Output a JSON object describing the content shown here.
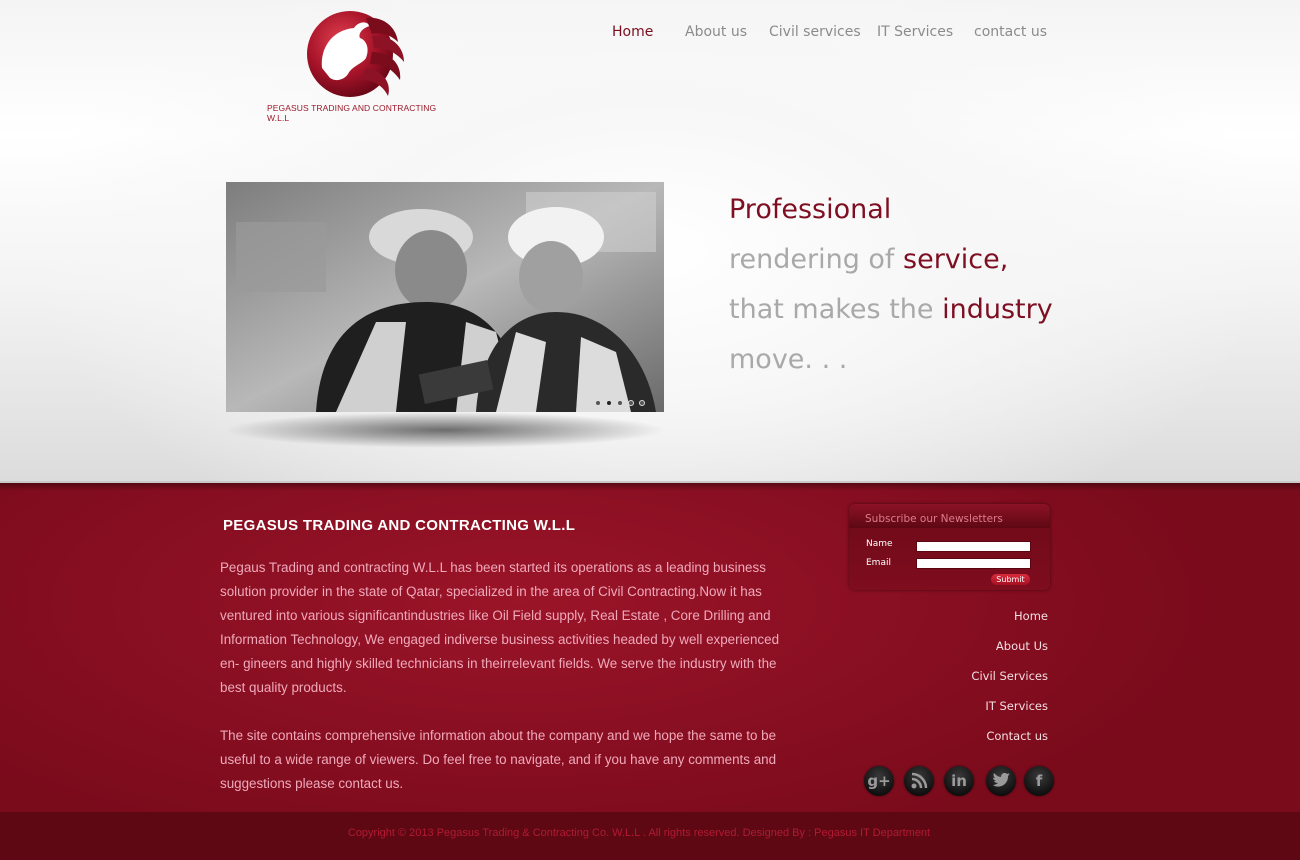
{
  "logo": {
    "text": "PEGASUS TRADING AND CONTRACTING W.L.L"
  },
  "nav": [
    {
      "label": "Home",
      "active": true
    },
    {
      "label": "About us"
    },
    {
      "label": "Civil services"
    },
    {
      "label": "IT Services"
    },
    {
      "label": "contact us"
    }
  ],
  "slider": {
    "dots": 5,
    "active_dot": 2
  },
  "tagline": {
    "line1": {
      "red": "Professional"
    },
    "line2": {
      "grey": "rendering of ",
      "red": "service,"
    },
    "line3": {
      "grey": "that makes the ",
      "red": "industry"
    },
    "line4": {
      "grey": "move. . ."
    }
  },
  "footer": {
    "company_title": "PEGASUS TRADING AND CONTRACTING W.L.L",
    "para1": "Pegaus Trading and contracting W.L.L has been started its operations as a leading business solution provider in the state of Qatar, specialized in the area of Civil Contracting.Now it has ventured into various significantindustries like Oil Field supply, Real Estate , Core Drilling and Information Technology, We engaged indiverse business activities headed by well experienced en- gineers and highly skilled technicians in theirrelevant fields. We serve the industry with the best quality products.",
    "para2": "The site contains comprehensive information about the company and we hope the same to be useful to a wide range of viewers. Do feel free to navigate, and if you have any comments and suggestions please contact us.",
    "newsletter": {
      "title": "Subscribe our Newsletters",
      "name_label": "Name",
      "email_label": "Email",
      "submit_label": "Submit",
      "name_value": "",
      "email_value": ""
    },
    "links": [
      "Home",
      "About Us",
      "Civil Services",
      "IT Services",
      "Contact us"
    ],
    "social": [
      {
        "icon": "google-plus-icon",
        "glyph": "g+"
      },
      {
        "icon": "rss-icon",
        "glyph": ""
      },
      {
        "icon": "linkedin-icon",
        "glyph": "in"
      },
      {
        "icon": "twitter-icon",
        "glyph": ""
      },
      {
        "icon": "facebook-icon",
        "glyph": "f"
      }
    ],
    "copyright": "Copyright © 2013 Pegasus Trading & Contracting Co. W.L.L . All rights reserved. Designed By : Pegasus IT Department"
  },
  "colors": {
    "brand_red": "#7e0f22",
    "nav_grey": "#8b8b8b",
    "footer_bg": "#8a0f22",
    "bottom_bar": "#5e0814"
  }
}
